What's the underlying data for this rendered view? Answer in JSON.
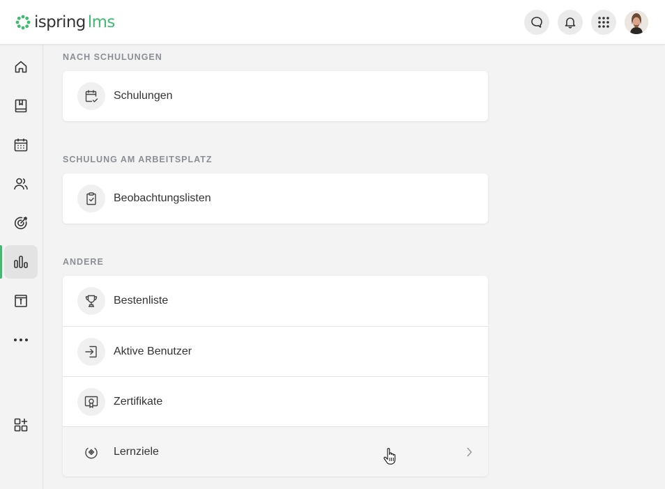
{
  "header": {
    "logo_text_1": "ispring",
    "logo_text_2": "lms",
    "brand_color": "#3fba6f",
    "actions": [
      {
        "icon": "chat-bubble-icon"
      },
      {
        "icon": "bell-icon"
      },
      {
        "icon": "apps-grid-icon"
      },
      {
        "icon": "user-avatar"
      }
    ]
  },
  "sidebar": {
    "items": [
      {
        "icon": "home-icon"
      },
      {
        "icon": "book-icon"
      },
      {
        "icon": "calendar-icon"
      },
      {
        "icon": "users-icon"
      },
      {
        "icon": "target-icon"
      },
      {
        "icon": "bar-chart-icon",
        "active": true
      },
      {
        "icon": "info-box-icon"
      },
      {
        "icon": "more-dots-icon"
      }
    ],
    "bottom_icon": "add-widget-icon"
  },
  "sections": [
    {
      "title": "NACH SCHULUNGEN",
      "items": [
        {
          "label": "Schulungen",
          "icon": "calendar-check-icon"
        }
      ]
    },
    {
      "title": "SCHULUNG AM ARBEITSPLATZ",
      "items": [
        {
          "label": "Beobachtungslisten",
          "icon": "clipboard-check-icon"
        }
      ]
    },
    {
      "title": "ANDERE",
      "items": [
        {
          "label": "Bestenliste",
          "icon": "trophy-icon"
        },
        {
          "label": "Aktive Benutzer",
          "icon": "login-icon"
        },
        {
          "label": "Zertifikate",
          "icon": "certificate-icon"
        },
        {
          "label": "Lernziele",
          "icon": "goal-icon",
          "hovered": true
        }
      ]
    }
  ]
}
